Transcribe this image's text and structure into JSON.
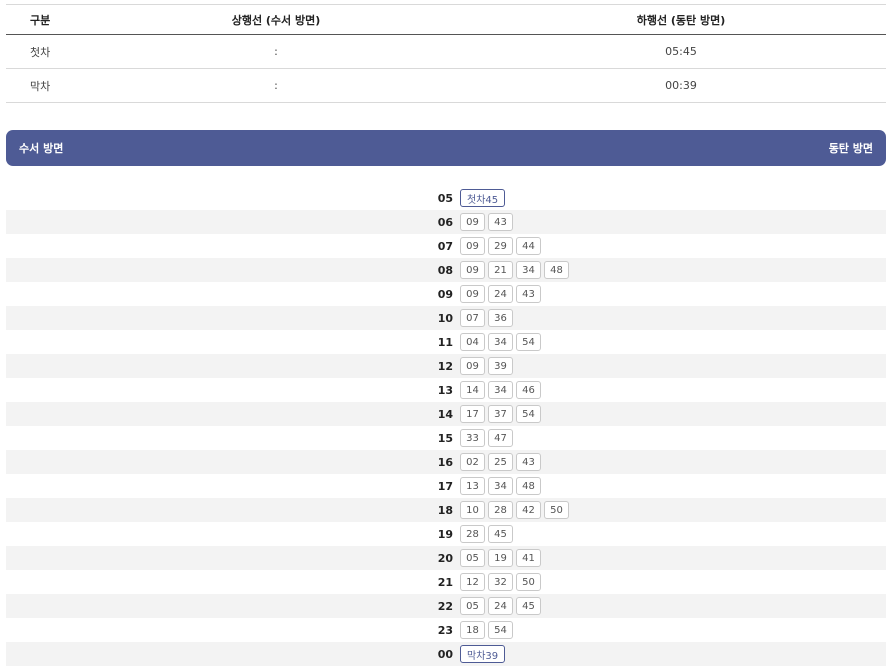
{
  "summary": {
    "headers": [
      "구분",
      "상행선 (수서 방면)",
      "하행선 (동탄 방면)"
    ],
    "rows": [
      {
        "label": "첫차",
        "up": ":",
        "down": "05:45"
      },
      {
        "label": "막차",
        "up": ":",
        "down": "00:39"
      }
    ]
  },
  "direction_bar": {
    "left": "수서 방면",
    "right": "동탄 방면"
  },
  "timetable": [
    {
      "hour": "05",
      "mins": [
        "첫차45"
      ]
    },
    {
      "hour": "06",
      "mins": [
        "09",
        "43"
      ]
    },
    {
      "hour": "07",
      "mins": [
        "09",
        "29",
        "44"
      ]
    },
    {
      "hour": "08",
      "mins": [
        "09",
        "21",
        "34",
        "48"
      ]
    },
    {
      "hour": "09",
      "mins": [
        "09",
        "24",
        "43"
      ]
    },
    {
      "hour": "10",
      "mins": [
        "07",
        "36"
      ]
    },
    {
      "hour": "11",
      "mins": [
        "04",
        "34",
        "54"
      ]
    },
    {
      "hour": "12",
      "mins": [
        "09",
        "39"
      ]
    },
    {
      "hour": "13",
      "mins": [
        "14",
        "34",
        "46"
      ]
    },
    {
      "hour": "14",
      "mins": [
        "17",
        "37",
        "54"
      ]
    },
    {
      "hour": "15",
      "mins": [
        "33",
        "47"
      ]
    },
    {
      "hour": "16",
      "mins": [
        "02",
        "25",
        "43"
      ]
    },
    {
      "hour": "17",
      "mins": [
        "13",
        "34",
        "48"
      ]
    },
    {
      "hour": "18",
      "mins": [
        "10",
        "28",
        "42",
        "50"
      ]
    },
    {
      "hour": "19",
      "mins": [
        "28",
        "45"
      ]
    },
    {
      "hour": "20",
      "mins": [
        "05",
        "19",
        "41"
      ]
    },
    {
      "hour": "21",
      "mins": [
        "12",
        "32",
        "50"
      ]
    },
    {
      "hour": "22",
      "mins": [
        "05",
        "24",
        "45"
      ]
    },
    {
      "hour": "23",
      "mins": [
        "18",
        "54"
      ]
    },
    {
      "hour": "00",
      "mins": [
        "막차39"
      ]
    }
  ],
  "colors": {
    "accent": "#4e5b95",
    "row_shade": "#f3f3f3"
  }
}
